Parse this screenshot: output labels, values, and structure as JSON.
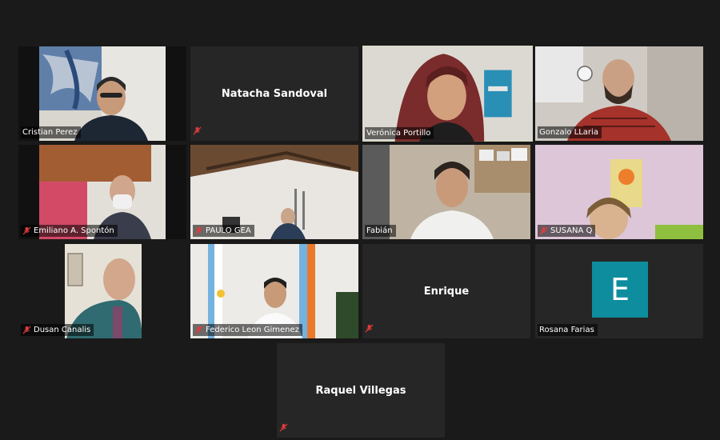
{
  "participants": [
    {
      "name": "Cristian Perez",
      "muted": false,
      "video": true
    },
    {
      "name": "Natacha Sandoval",
      "muted": true,
      "video": false
    },
    {
      "name": "Verónica Portillo",
      "muted": false,
      "video": true,
      "speaking": true
    },
    {
      "name": "Gonzalo LLaria",
      "muted": false,
      "video": true
    },
    {
      "name": "Emiliano A. Spontón",
      "muted": true,
      "video": true
    },
    {
      "name": "PAULO GEA",
      "muted": true,
      "video": true
    },
    {
      "name": "Fabián",
      "muted": false,
      "video": true
    },
    {
      "name": "SUSANA Q",
      "muted": true,
      "video": true
    },
    {
      "name": "Dusan Canalis",
      "muted": true,
      "video": true
    },
    {
      "name": "Federico Leon Gimenez",
      "muted": true,
      "video": true
    },
    {
      "name": "Enrique",
      "muted": true,
      "video": false
    },
    {
      "name": "Rosana Farias",
      "muted": false,
      "video": false,
      "avatar_letter": "E",
      "avatar_color": "#0e8d9e"
    },
    {
      "name": "Raquel Villegas",
      "muted": true,
      "video": false
    }
  ],
  "colors": {
    "active_speaker_border": "#a5e33a",
    "mute_icon": "#e03b3b",
    "tile_bg": "#262626"
  }
}
